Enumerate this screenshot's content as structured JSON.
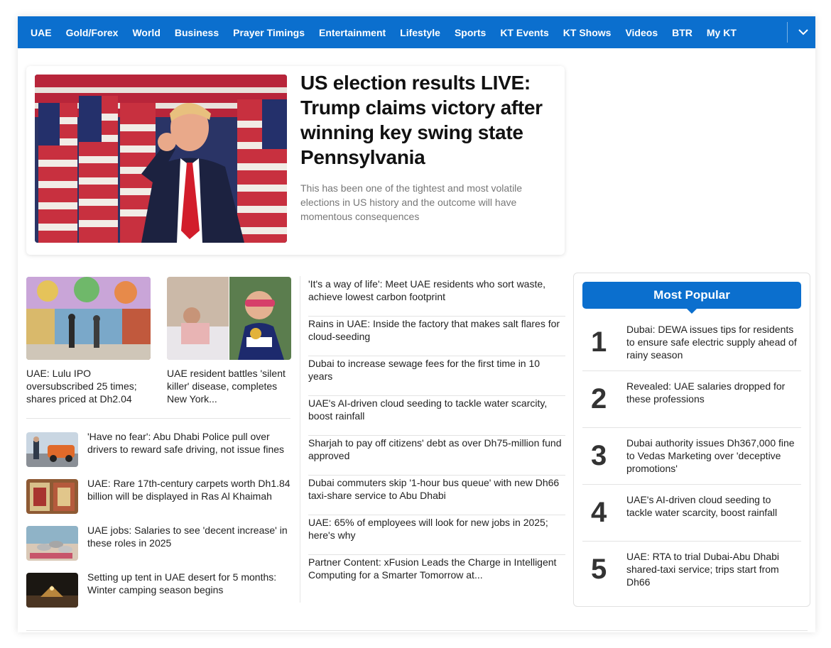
{
  "nav": {
    "items": [
      "UAE",
      "Gold/Forex",
      "World",
      "Business",
      "Prayer Timings",
      "Entertainment",
      "Lifestyle",
      "Sports",
      "KT Events",
      "KT Shows",
      "Videos",
      "BTR",
      "My KT"
    ]
  },
  "hero": {
    "title": "US election results LIVE: Trump claims victory after winning key swing state Pennsylvania",
    "description": "This has been one of the tightest and most volatile elections in US history and the outcome will have momentous consequences"
  },
  "cards": [
    {
      "text": "UAE: Lulu IPO oversubscribed 25 times; shares priced at Dh2.04"
    },
    {
      "text": "UAE resident battles 'silent killer' disease, completes New York..."
    }
  ],
  "left_list": [
    {
      "text": "'Have no fear': Abu Dhabi Police pull over drivers to reward safe driving, not issue fines"
    },
    {
      "text": "UAE: Rare 17th-century carpets worth Dh1.84 billion will be displayed in Ras Al Khaimah"
    },
    {
      "text": "UAE jobs: Salaries to see 'decent increase' in these roles in 2025"
    },
    {
      "text": "Setting up tent in UAE desert for 5 months: Winter camping season begins"
    }
  ],
  "middle_list": [
    {
      "text": "'It's a way of life': Meet UAE residents who sort waste, achieve lowest carbon footprint"
    },
    {
      "text": "Rains in UAE: Inside the factory that makes salt flares for cloud-seeding"
    },
    {
      "text": "Dubai to increase sewage fees for the first time in 10 years"
    },
    {
      "text": "UAE's AI-driven cloud seeding to tackle water scarcity, boost rainfall"
    },
    {
      "text": "Sharjah to pay off citizens' debt as over Dh75-million fund approved"
    },
    {
      "text": "Dubai commuters skip '1-hour bus queue' with new Dh66 taxi-share service to Abu Dhabi"
    },
    {
      "text": "UAE: 65% of employees will look for new jobs in 2025; here's why"
    },
    {
      "text": "Partner Content: xFusion Leads the Charge in Intelligent Computing for a Smarter Tomorrow at..."
    }
  ],
  "popular": {
    "title": "Most Popular",
    "items": [
      {
        "num": "1",
        "text": "Dubai: DEWA issues tips for residents to ensure safe electric supply ahead of rainy season"
      },
      {
        "num": "2",
        "text": "Revealed: UAE salaries dropped for these professions"
      },
      {
        "num": "3",
        "text": "Dubai authority issues Dh367,000 fine to Vedas Marketing over 'deceptive promotions'"
      },
      {
        "num": "4",
        "text": "UAE's AI-driven cloud seeding to tackle water scarcity, boost rainfall"
      },
      {
        "num": "5",
        "text": "UAE: RTA to trial Dubai-Abu Dhabi shared-taxi service; trips start from Dh66"
      }
    ]
  },
  "colors": {
    "brand": "#0b6fce"
  },
  "icons": {
    "menu_toggle": "chevron-down-icon"
  }
}
